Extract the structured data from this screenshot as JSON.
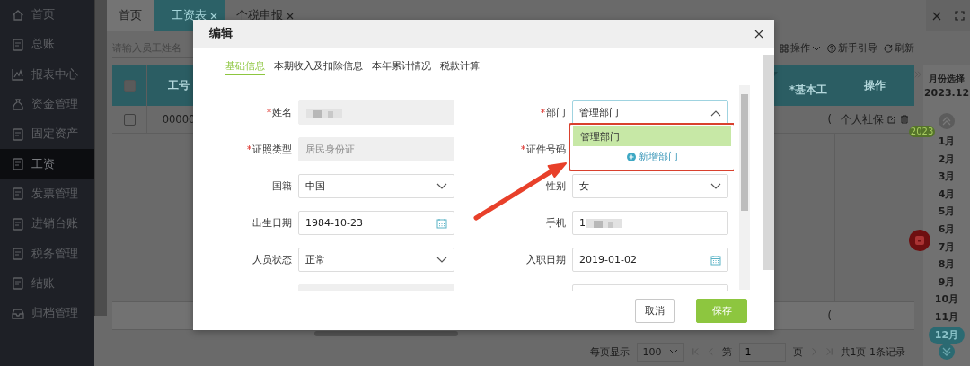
{
  "sidebar": {
    "items": [
      {
        "label": "首页",
        "selected": false
      },
      {
        "label": "总账",
        "selected": false
      },
      {
        "label": "报表中心",
        "selected": false
      },
      {
        "label": "资金管理",
        "selected": false
      },
      {
        "label": "固定资产",
        "selected": false
      },
      {
        "label": "工资",
        "selected": true
      },
      {
        "label": "发票管理",
        "selected": false
      },
      {
        "label": "进销台账",
        "selected": false
      },
      {
        "label": "税务管理",
        "selected": false
      },
      {
        "label": "结账",
        "selected": false
      },
      {
        "label": "归档管理",
        "selected": false
      }
    ]
  },
  "tabs": [
    {
      "label": "首页",
      "selected": false,
      "closable": false
    },
    {
      "label": "工资表",
      "selected": true,
      "closable": true
    },
    {
      "label": "个税申报",
      "selected": false,
      "closable": true
    }
  ],
  "search": {
    "placeholder": "请输入员工姓名"
  },
  "toolbar": [
    {
      "label": "操作",
      "kind": "menu"
    },
    {
      "label": "新手引导",
      "kind": "help"
    },
    {
      "label": "刷新",
      "kind": "refresh"
    }
  ],
  "table": {
    "all_selected": false,
    "columns": [
      "工号",
      "*基本工",
      "操作"
    ],
    "rows": [
      {
        "selected": false,
        "cells": [
          "00000",
          "("
        ],
        "action": "个人社保"
      }
    ],
    "summary": "("
  },
  "month_panel": {
    "title": "月份选择",
    "current": "2023.12",
    "year": "2023",
    "months": [
      {
        "label": "1月",
        "selected": false
      },
      {
        "label": "2月",
        "selected": false
      },
      {
        "label": "3月",
        "selected": false
      },
      {
        "label": "4月",
        "selected": false
      },
      {
        "label": "5月",
        "selected": false
      },
      {
        "label": "6月",
        "selected": false
      },
      {
        "label": "7月",
        "selected": false
      },
      {
        "label": "8月",
        "selected": false
      },
      {
        "label": "9月",
        "selected": false
      },
      {
        "label": "10月",
        "selected": false
      },
      {
        "label": "11月",
        "selected": false
      },
      {
        "label": "12月",
        "selected": true
      }
    ]
  },
  "pagination": {
    "page_size_label": "每页显示",
    "page_size": "100",
    "page_prefix": "第",
    "page": "1",
    "page_suffix": "页",
    "summary": "共1页 1条记录"
  },
  "dialog": {
    "title": "编辑",
    "tabs": [
      {
        "label": "基础信息",
        "selected": true
      },
      {
        "label": "本期收入及扣除信息",
        "selected": false
      },
      {
        "label": "本年累计情况",
        "selected": false
      },
      {
        "label": "税款计算",
        "selected": false
      }
    ],
    "fields": [
      {
        "label": "姓名",
        "required": true,
        "kind": "text",
        "disabled": true,
        "blurred": true
      },
      {
        "label": "部门",
        "required": true,
        "kind": "select",
        "value": "管理部门",
        "expanded": true
      },
      {
        "label": "证照类型",
        "required": true,
        "kind": "text",
        "disabled": true,
        "value": "居民身份证"
      },
      {
        "label": "证件号码",
        "required": true
      },
      {
        "label": "国籍",
        "required": false,
        "kind": "select",
        "value": "中国",
        "expanded": false
      },
      {
        "label": "性别",
        "required": false,
        "kind": "select",
        "value": "女",
        "expanded": false
      },
      {
        "label": "出生日期",
        "required": false,
        "kind": "date",
        "value": "1984-10-23"
      },
      {
        "label": "手机",
        "required": false,
        "kind": "text",
        "value": "1",
        "blurred": true
      },
      {
        "label": "人员状态",
        "required": false,
        "kind": "select",
        "value": "正常",
        "expanded": false
      },
      {
        "label": "入职日期",
        "required": false,
        "kind": "date",
        "value": "2019-01-02"
      },
      {
        "kind": "text",
        "disabled": true
      },
      {
        "kind": "text"
      }
    ],
    "dropdown": {
      "options": [
        {
          "label": "管理部门",
          "selected": true
        }
      ],
      "add_label": "新增部门"
    },
    "buttons": [
      {
        "label": "取消",
        "kind": "secondary"
      },
      {
        "label": "保存",
        "kind": "primary"
      }
    ]
  }
}
